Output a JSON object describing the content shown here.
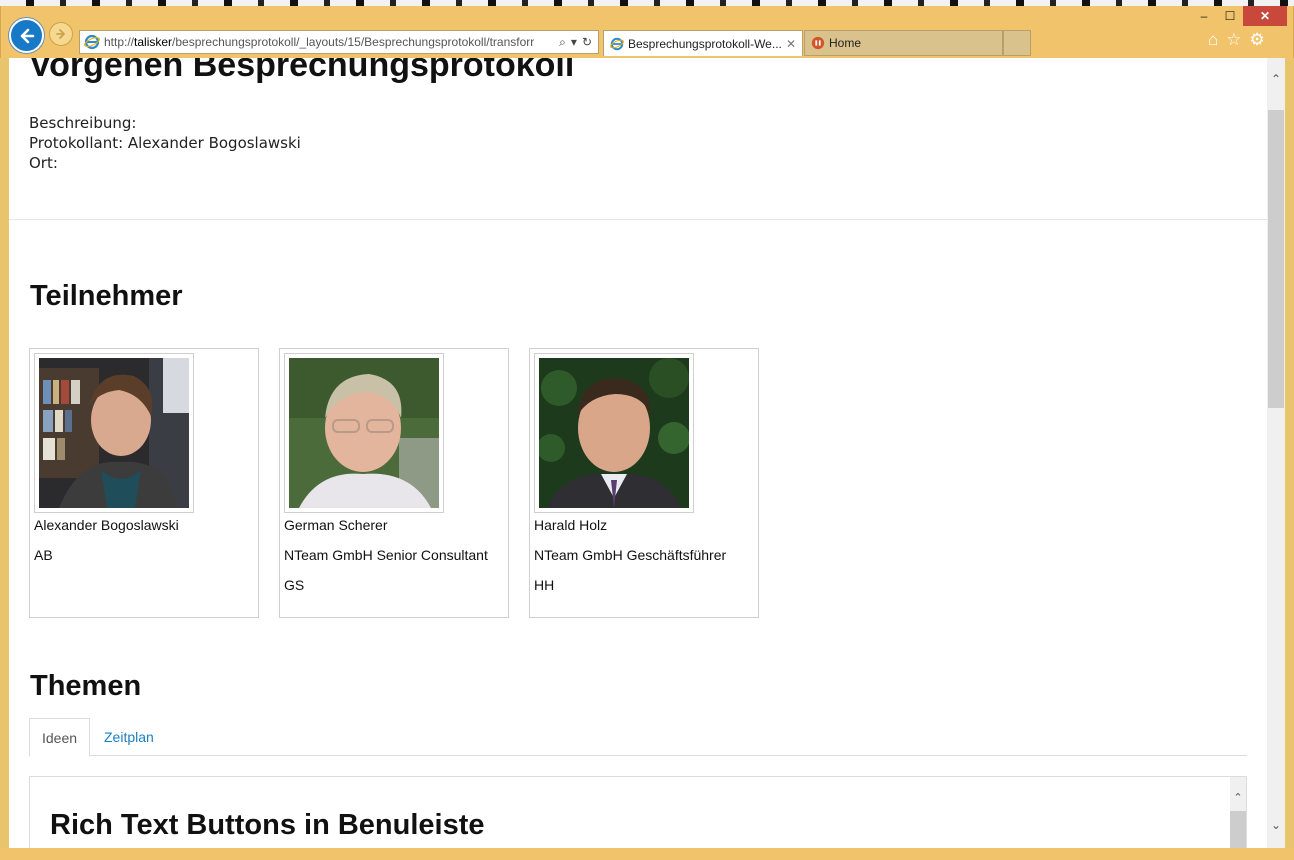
{
  "browser": {
    "url_prefix": "http://",
    "url_host": "talisker",
    "url_path": "/besprechungsprotokoll/_layouts/15/Besprechungsprotokoll/transforr",
    "tabs": [
      {
        "title": "Besprechungsprotokoll-We...",
        "active": true
      },
      {
        "title": "Home",
        "active": false
      }
    ],
    "window_controls": {
      "minimize": "–",
      "maximize": "☐",
      "close": "✕"
    },
    "icons": [
      "home-icon",
      "favorites-star-icon",
      "settings-gear-icon"
    ]
  },
  "page": {
    "title": "Vorgehen Besprechungsprotokoll",
    "meta": {
      "beschreibung": "Beschreibung:",
      "protokollant": "Protokollant: Alexander Bogoslawski",
      "ort": "Ort:"
    },
    "participants_heading": "Teilnehmer",
    "participants": [
      {
        "name": "Alexander Bogoslawski",
        "company_role": "AB",
        "initials": ""
      },
      {
        "name": "German Scherer",
        "company_role": "NTeam GmbH Senior Consultant",
        "initials": "GS"
      },
      {
        "name": "Harald Holz",
        "company_role": "NTeam GmbH Geschäftsführer",
        "initials": "HH"
      }
    ],
    "topics_heading": "Themen",
    "topic_tabs": [
      {
        "label": "Ideen",
        "active": true
      },
      {
        "label": "Zeitplan",
        "active": false
      }
    ],
    "panel_title": "Rich Text Buttons in Benuleiste"
  },
  "colors": {
    "frame": "#f1c36a",
    "link": "#1a7fc1",
    "ie_blue": "#1879c6"
  }
}
